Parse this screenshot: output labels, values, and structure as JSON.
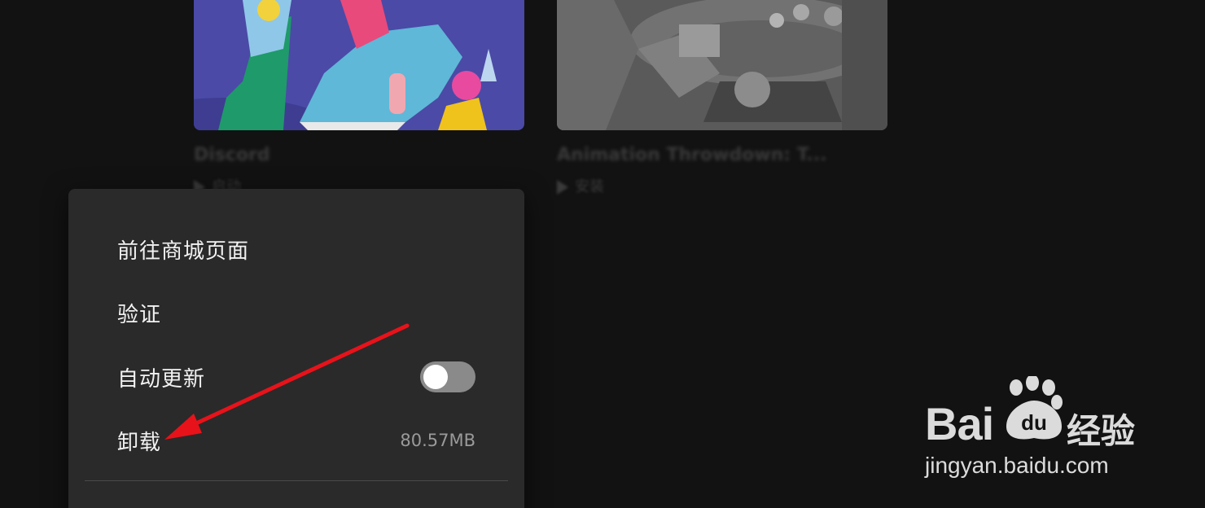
{
  "library": {
    "cards": [
      {
        "title": "Discord",
        "status": "启动"
      },
      {
        "title": "Animation Throwdown: T...",
        "status": "安装"
      }
    ]
  },
  "context_menu": {
    "items": [
      {
        "label": "前往商城页面"
      },
      {
        "label": "验证"
      },
      {
        "label": "自动更新",
        "toggle_on": false
      },
      {
        "label": "卸载",
        "size": "80.57MB"
      }
    ]
  },
  "annotation": {
    "color": "#e8121a"
  },
  "watermark": {
    "logo_text": "Bai",
    "logo_paw_text": "du",
    "brand_cn": "经验",
    "url": "jingyan.baidu.com"
  }
}
